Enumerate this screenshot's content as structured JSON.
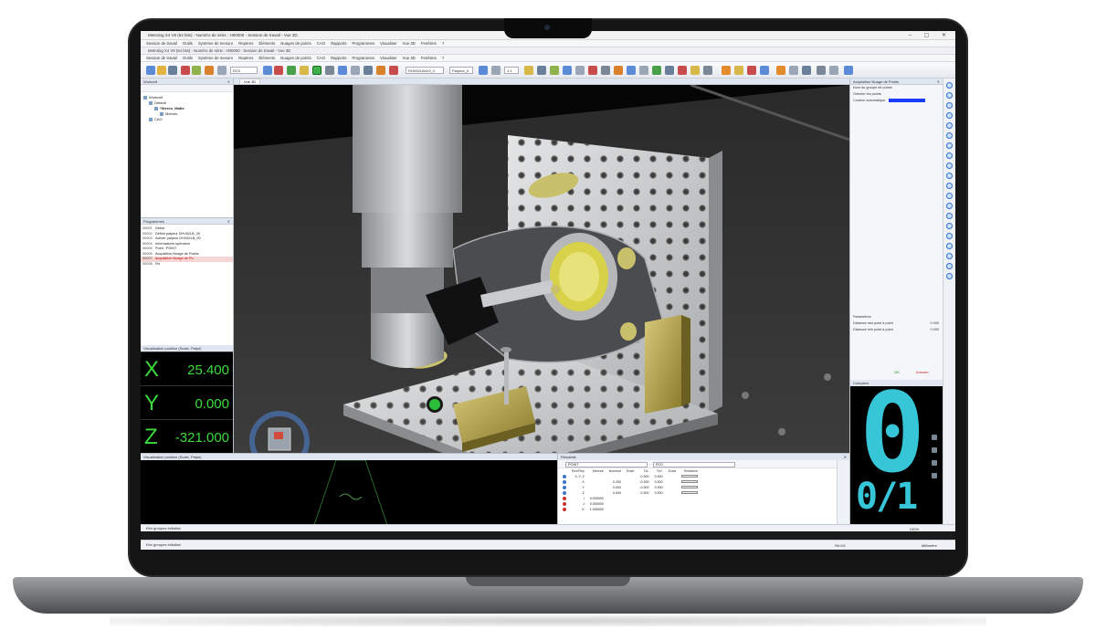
{
  "window": {
    "title": "Metrolog X4 V9 (64 bits) - Numéro de série : H00000 - Session de travail - Vue 3D",
    "title_short": "Metrolog X4 V9 (64 bits) - Numéro de série : H00000 - Session de travail - Vue 3D"
  },
  "menu": [
    "Session de travail",
    "Outils",
    "Système de mesure",
    "Repères",
    "Éléments",
    "Nuages de points",
    "CAO",
    "Rapports",
    "Programmes",
    "Visualiser",
    "Vue 3D",
    "Fenêtres",
    "?"
  ],
  "toolbar": {
    "frame_combo": "RC0",
    "probe_combo": "DHV62LB4X2_0",
    "tool_combo": "Palpeur_0",
    "scale_combo": "1:1"
  },
  "left_panel": {
    "title": "Workcell",
    "items": [
      "Workcell",
      "Default",
      "*Stereo_Matte",
      "Metrolo",
      "CAO"
    ]
  },
  "program_panel": {
    "title": "Programmes",
    "rows": [
      {
        "num": "00001",
        "text": "Début"
      },
      {
        "num": "00002",
        "text": "Définir palpeur DHV62LB_00"
      },
      {
        "num": "00003",
        "text": "Activer palpeur DHV62LB_00"
      },
      {
        "num": "00004",
        "text": "Informations opérateur"
      },
      {
        "num": "00005",
        "text": "Point : POINT"
      },
      {
        "num": "00006",
        "text": "Acquisition Nuage de Points"
      },
      {
        "num": "00007",
        "text": "Acquisition Nuage de Po"
      },
      {
        "num": "00008",
        "text": "Fin"
      }
    ]
  },
  "dro": {
    "title": "Visualisation position (Scale, Palpe)",
    "axes": [
      {
        "axis": "X",
        "value": "25.400"
      },
      {
        "axis": "Y",
        "value": "0.000"
      },
      {
        "axis": "Z",
        "value": "-321.000"
      }
    ]
  },
  "view3d": {
    "tab": "Vue 3D"
  },
  "right_panel": {
    "title": "Acquisition Nuage de Points",
    "fields": [
      "Nom du groupe de points",
      "Orienter les points",
      "Couleur automatique",
      "Paramètres",
      "Distance min point à point",
      "Distance min point à point"
    ],
    "values": [
      "0.000",
      "0.000"
    ],
    "buttons": {
      "ok": "OK",
      "cancel": "Annuler"
    },
    "color": "#1a3cff"
  },
  "counter": {
    "title": "Compteur",
    "big": "0",
    "small": "0/1",
    "color": "#37c6d8"
  },
  "dro2": {
    "title": "Visualisation position (Scale, Palpe)"
  },
  "results": {
    "title": "Résultats",
    "combo1": "POINT",
    "combo2": "RC0",
    "headers": [
      "Elm/Rep",
      "Mesuré",
      "Nominal",
      "Ecart",
      "Tol-",
      "Tol+",
      "Ecart",
      "Tendance"
    ],
    "rows": [
      {
        "label": "X, Y, Z",
        "measured": "",
        "nominal": "",
        "tolm": "-0.300",
        "tolp": "0.300"
      },
      {
        "label": "X",
        "measured": "",
        "nominal": "0.200",
        "tolm": "-0.300",
        "tolp": "0.300"
      },
      {
        "label": "Y",
        "measured": "",
        "nominal": "0.000",
        "tolm": "-0.300",
        "tolp": "0.300"
      },
      {
        "label": "Z",
        "measured": "",
        "nominal": "0.000",
        "tolm": "-0.300",
        "tolp": "0.300"
      },
      {
        "label": "I",
        "measured": "0.000000",
        "nominal": "",
        "tolm": "",
        "tolp": ""
      },
      {
        "label": "J",
        "measured": "0.000000",
        "nominal": "",
        "tolm": "",
        "tolp": ""
      },
      {
        "label": "K",
        "measured": "1.000000",
        "nominal": "",
        "tolm": "",
        "tolp": ""
      }
    ]
  },
  "status": {
    "text1": "Elm groupes initialisé",
    "text2": "Elm groupes initialisé",
    "right1": "100%",
    "right2": "Ré:0/1",
    "unit": "Millimètre"
  }
}
